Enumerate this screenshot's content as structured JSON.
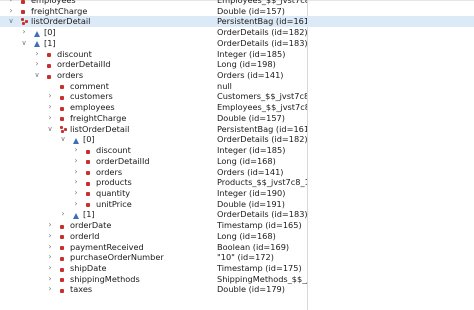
{
  "rows": [
    {
      "name": "employees",
      "value": "Employees_$$_jvst7c8_5",
      "icon": "field",
      "toggle": "collapsed"
    },
    {
      "name": "freightCharge",
      "value": "Double  (id=157)",
      "icon": "field",
      "toggle": "collapsed"
    },
    {
      "name": "listOrderDetail",
      "value": "PersistentBag  (id=161)",
      "icon": "multi",
      "toggle": "expanded",
      "selected": true
    },
    {
      "name": "[0]",
      "value": "OrderDetails  (id=182)",
      "icon": "arr",
      "toggle": "collapsed"
    },
    {
      "name": "[1]",
      "value": "OrderDetails  (id=183)",
      "icon": "arr",
      "toggle": "expanded"
    },
    {
      "name": "discount",
      "value": "Integer  (id=185)",
      "icon": "field",
      "toggle": "collapsed"
    },
    {
      "name": "orderDetailId",
      "value": "Long  (id=198)",
      "icon": "field",
      "toggle": "collapsed"
    },
    {
      "name": "orders",
      "value": "Orders  (id=141)",
      "icon": "field",
      "toggle": "expanded"
    },
    {
      "name": "comment",
      "value": "null",
      "icon": "field",
      "toggle": "none"
    },
    {
      "name": "customers",
      "value": "Customers_$$_jvst7c8_3",
      "icon": "field",
      "toggle": "collapsed"
    },
    {
      "name": "employees",
      "value": "Employees_$$_jvst7c8_5",
      "icon": "field",
      "toggle": "collapsed"
    },
    {
      "name": "freightCharge",
      "value": "Double  (id=157)",
      "icon": "field",
      "toggle": "collapsed"
    },
    {
      "name": "listOrderDetail",
      "value": "PersistentBag  (id=161)",
      "icon": "multi",
      "toggle": "expanded"
    },
    {
      "name": "[0]",
      "value": "OrderDetails  (id=182)",
      "icon": "arr",
      "toggle": "expanded"
    },
    {
      "name": "discount",
      "value": "Integer  (id=185)",
      "icon": "field",
      "toggle": "collapsed"
    },
    {
      "name": "orderDetailId",
      "value": "Long  (id=168)",
      "icon": "field",
      "toggle": "collapsed"
    },
    {
      "name": "orders",
      "value": "Orders  (id=141)",
      "icon": "field",
      "toggle": "collapsed"
    },
    {
      "name": "products",
      "value": "Products_$$_jvst7c8_1  (id",
      "icon": "field",
      "toggle": "collapsed"
    },
    {
      "name": "quantity",
      "value": "Integer  (id=190)",
      "icon": "field",
      "toggle": "collapsed"
    },
    {
      "name": "unitPrice",
      "value": "Double  (id=191)",
      "icon": "field",
      "toggle": "collapsed"
    },
    {
      "name": "[1]",
      "value": "OrderDetails  (id=183)",
      "icon": "arr",
      "toggle": "collapsed"
    },
    {
      "name": "orderDate",
      "value": "Timestamp  (id=165)",
      "icon": "field",
      "toggle": "collapsed"
    },
    {
      "name": "orderId",
      "value": "Long  (id=168)",
      "icon": "field",
      "toggle": "collapsed"
    },
    {
      "name": "paymentReceived",
      "value": "Boolean  (id=169)",
      "icon": "field",
      "toggle": "collapsed"
    },
    {
      "name": "purchaseOrderNumber",
      "value": "\"10\"  (id=172)",
      "icon": "field",
      "toggle": "collapsed"
    },
    {
      "name": "shipDate",
      "value": "Timestamp  (id=175)",
      "icon": "field",
      "toggle": "collapsed"
    },
    {
      "name": "shippingMethods",
      "value": "ShippingMethods_$$_jvst...",
      "icon": "field",
      "toggle": "collapsed"
    },
    {
      "name": "taxes",
      "value": "Double  (id=179)",
      "icon": "field",
      "toggle": "collapsed"
    }
  ]
}
